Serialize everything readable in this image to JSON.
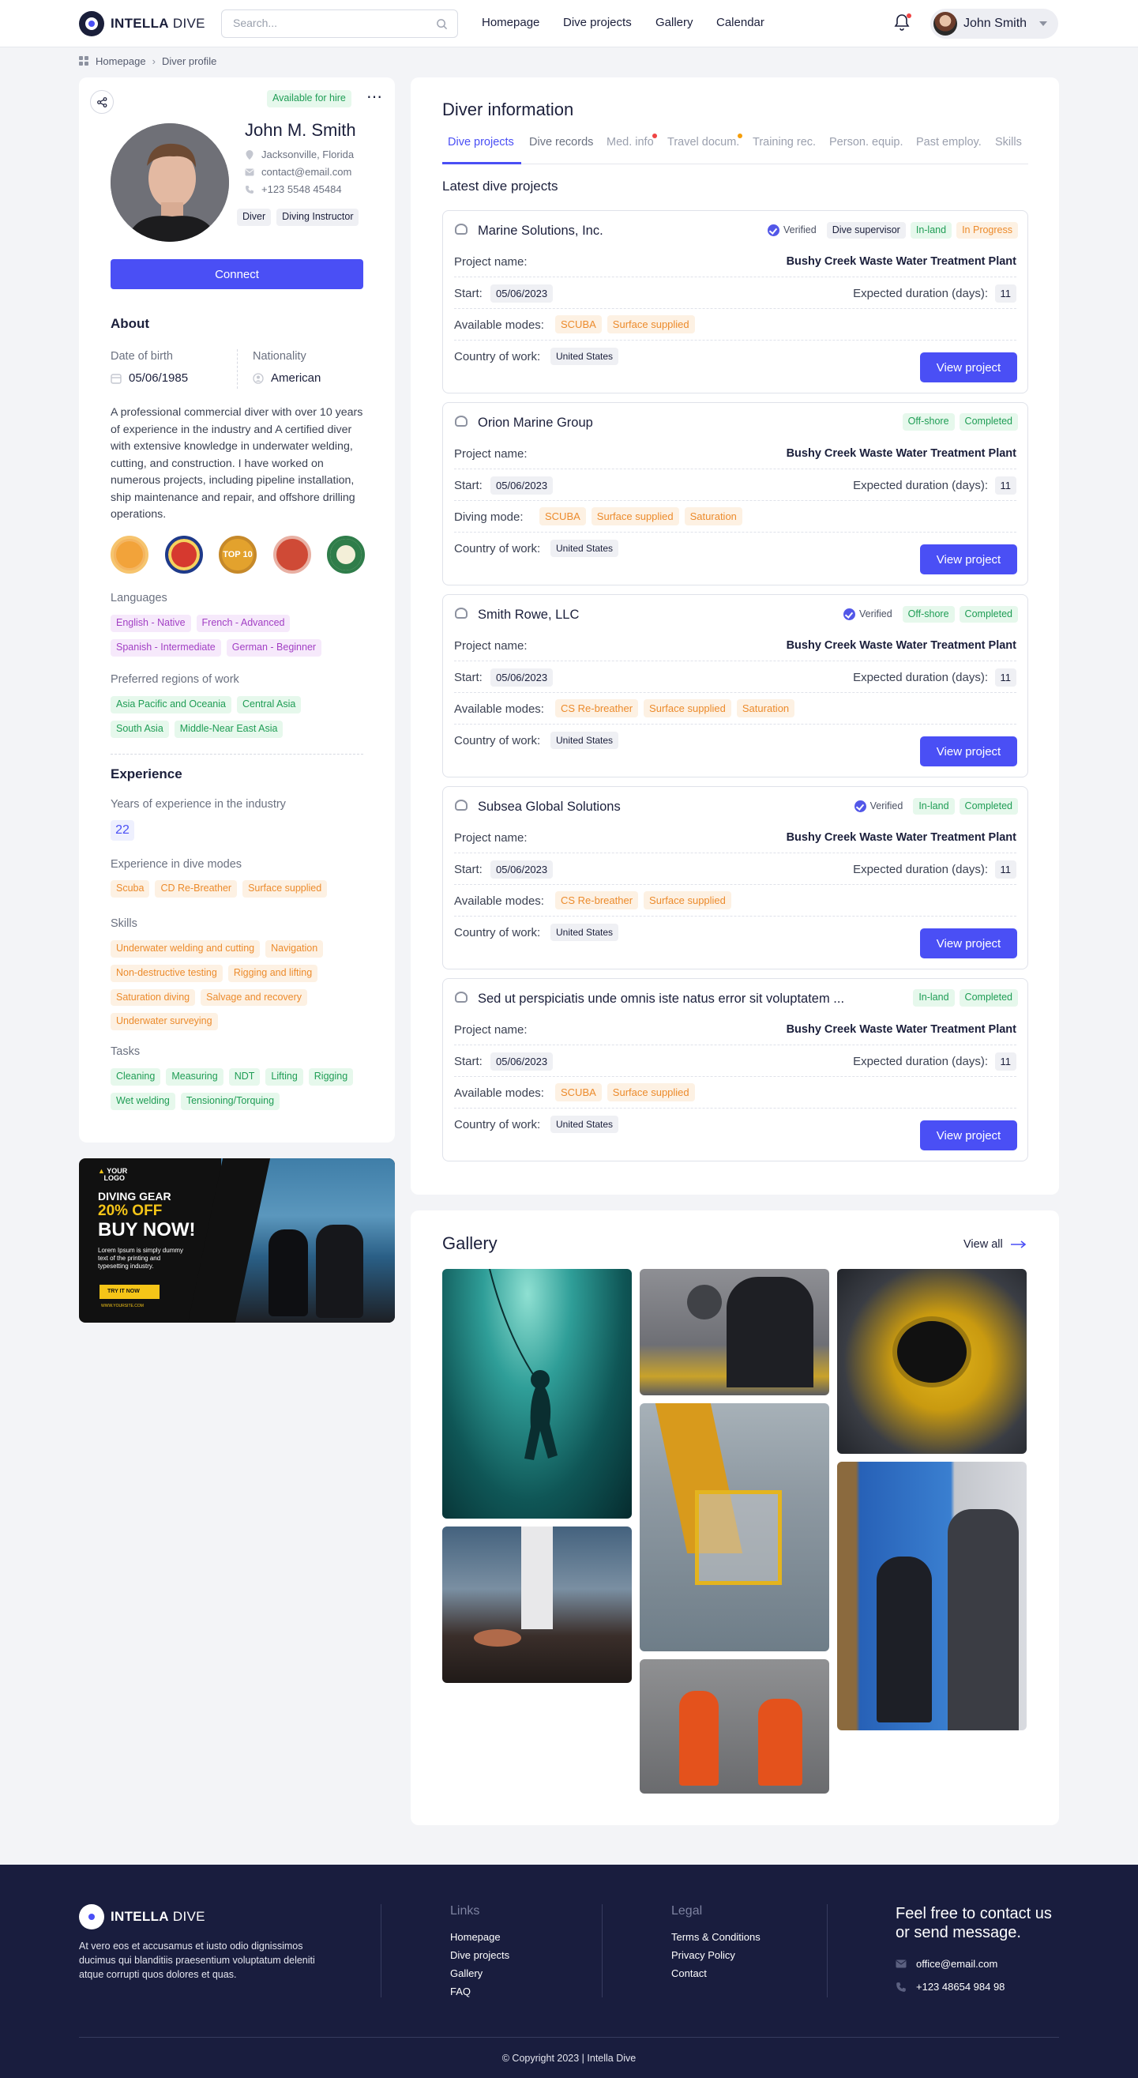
{
  "header": {
    "brand_bold": "INTELLA",
    "brand_light": "DIVE",
    "search_placeholder": "Search...",
    "nav": [
      "Homepage",
      "Dive projects",
      "Gallery",
      "Calendar"
    ],
    "user_name": "John Smith",
    "accent": "#4a4ff5"
  },
  "breadcrumb": [
    "Homepage",
    "Diver profile"
  ],
  "profile": {
    "status": "Available for hire",
    "name": "John M. Smith",
    "location": "Jacksonville, Florida",
    "email": "contact@email.com",
    "phone": "+123 5548 45484",
    "roles": [
      "Diver",
      "Diving Instructor"
    ],
    "connect_label": "Connect",
    "about_title": "About",
    "dob_label": "Date of birth",
    "dob": "05/06/1985",
    "nationality_label": "Nationality",
    "nationality": "American",
    "bio": "A professional commercial diver with over 10 years of experience in the industry and A certified diver with extensive knowledge in underwater welding, cutting, and construction. I have worked on numerous projects, including pipeline installation, ship maintenance and repair, and offshore drilling operations.",
    "medals": [
      {
        "color": "#f2a33a",
        "label": ""
      },
      {
        "color": "#d6392f",
        "label": ""
      },
      {
        "color": "#e3a22d",
        "label": "TOP 10"
      },
      {
        "color": "#cf4a36",
        "label": ""
      },
      {
        "color": "#2f7d4a",
        "label": ""
      }
    ],
    "languages_label": "Languages",
    "languages": [
      "English - Native",
      "French - Advanced",
      "Spanish - Intermediate",
      "German - Beginner"
    ],
    "regions_label": "Preferred regions of work",
    "regions": [
      "Asia Pacific and Oceania",
      "Central Asia",
      "South Asia",
      "Middle-Near East Asia"
    ],
    "experience_title": "Experience",
    "years_label": "Years of experience in the industry",
    "years": "22",
    "modes_label": "Experience in dive modes",
    "modes": [
      "Scuba",
      "CD Re-Breather",
      "Surface supplied"
    ],
    "skills_label": "Skills",
    "skills": [
      "Underwater welding and cutting",
      "Navigation",
      "Non-destructive testing",
      "Rigging and lifting",
      "Saturation diving",
      "Salvage and recovery",
      "Underwater surveying"
    ],
    "tasks_label": "Tasks",
    "tasks": [
      "Cleaning",
      "Measuring",
      "NDT",
      "Lifting",
      "Rigging",
      "Wet welding",
      "Tensioning/Torquing"
    ]
  },
  "ad": {
    "logo_line1": "YOUR",
    "logo_line2": "LOGO",
    "line1": "DIVING GEAR",
    "line2": "20% OFF",
    "line3": "BUY NOW!",
    "body": "Lorem Ipsum is simply dummy text of the printing and typesetting industry.",
    "cta": "TRY IT NOW",
    "url": "WWW.YOURSITE.COM"
  },
  "diver_info": {
    "title": "Diver information",
    "tabs": [
      "Dive projects",
      "Dive records",
      "Med. info",
      "Travel docum.",
      "Training rec.",
      "Person. equip.",
      "Past employ.",
      "Skills"
    ],
    "latest_title": "Latest dive projects",
    "project_name_label": "Project name:",
    "start_label": "Start:",
    "duration_label": "Expected duration (days):",
    "country_label": "Country of work:",
    "view_label": "View project",
    "projects": [
      {
        "company": "Marine Solutions, Inc.",
        "verified": "Verified",
        "role": "Dive supervisor",
        "location": "In-land",
        "status": "In Progress",
        "project": "Bushy Creek Waste Water Treatment Plant",
        "start": "05/06/2023",
        "duration": "11",
        "modes_label": "Available modes:",
        "modes": [
          "SCUBA",
          "Surface supplied"
        ],
        "country": "United States"
      },
      {
        "company": "Orion Marine Group",
        "verified": "",
        "role": "",
        "location": "Off-shore",
        "status": "Completed",
        "project": "Bushy Creek Waste Water Treatment Plant",
        "start": "05/06/2023",
        "duration": "11",
        "modes_label": "Diving mode:",
        "modes": [
          "SCUBA",
          "Surface supplied",
          "Saturation"
        ],
        "country": "United States"
      },
      {
        "company": "Smith Rowe, LLC",
        "verified": "Verified",
        "role": "",
        "location": "Off-shore",
        "status": "Completed",
        "project": "Bushy Creek Waste Water Treatment Plant",
        "start": "05/06/2023",
        "duration": "11",
        "modes_label": "Available modes:",
        "modes": [
          "CS Re-breather",
          "Surface supplied",
          "Saturation"
        ],
        "country": "United States"
      },
      {
        "company": "Subsea Global Solutions",
        "verified": "Verified",
        "role": "",
        "location": "In-land",
        "status": "Completed",
        "project": "Bushy Creek Waste Water Treatment Plant",
        "start": "05/06/2023",
        "duration": "11",
        "modes_label": "Available modes:",
        "modes": [
          "CS Re-breather",
          "Surface supplied"
        ],
        "country": "United States"
      },
      {
        "company": "Sed ut perspiciatis unde omnis iste natus error sit voluptatem ...",
        "verified": "",
        "role": "",
        "location": "In-land",
        "status": "Completed",
        "project": "Bushy Creek Waste Water Treatment Plant",
        "start": "05/06/2023",
        "duration": "11",
        "modes_label": "Available modes:",
        "modes": [
          "SCUBA",
          "Surface supplied"
        ],
        "country": "United States"
      }
    ]
  },
  "gallery": {
    "title": "Gallery",
    "view_all": "View all"
  },
  "footer": {
    "brand_bold": "INTELLA",
    "brand_light": "DIVE",
    "about": "At vero eos et accusamus et iusto odio dignissimos ducimus qui blanditiis praesentium voluptatum deleniti atque corrupti quos dolores et quas.",
    "links_title": "Links",
    "links": [
      "Homepage",
      "Dive projects",
      "Gallery",
      "FAQ"
    ],
    "legal_title": "Legal",
    "legal": [
      "Terms & Conditions",
      "Privacy Policy",
      "Contact"
    ],
    "contact_title": "Feel free to contact us or send message.",
    "email": "office@email.com",
    "phone": "+123 48654 984 98",
    "copyright": "© Copyright 2023 | Intella Dive"
  }
}
